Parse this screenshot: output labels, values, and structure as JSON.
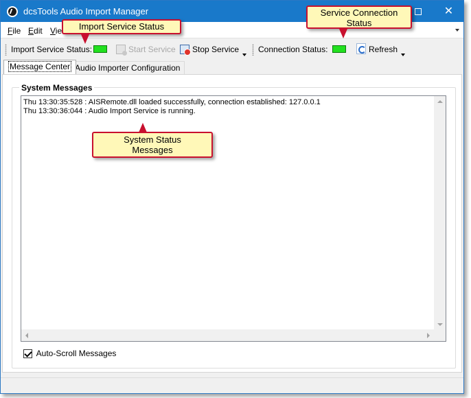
{
  "window": {
    "title": "dcsTools Audio Import Manager"
  },
  "menu": {
    "file": {
      "mnemonic": "F",
      "rest": "ile"
    },
    "edit": {
      "mnemonic": "E",
      "rest": "dit"
    },
    "view": {
      "mnemonic": "V",
      "rest": "ie"
    }
  },
  "toolbar": {
    "import_status_label": "Import Service Status:",
    "start_service_label": "Start Service",
    "stop_service_label": "Stop Service",
    "connection_status_label": "Connection Status:",
    "refresh_label": "Refresh",
    "status_color": "#22e01f"
  },
  "tabs": [
    {
      "label": "Message Center",
      "active": true
    },
    {
      "label": "Audio Importer Configuration",
      "active": false
    }
  ],
  "messages": {
    "group_title": "System Messages",
    "lines": [
      "Thu 13:30:35:528 : AISRemote.dll loaded successfully, connection established: 127.0.0.1",
      "Thu 13:30:36:044 : Audio Import Service is running."
    ]
  },
  "auto_scroll": {
    "label": "Auto-Scroll Messages",
    "checked": true
  },
  "callouts": {
    "import_status": "Import Service Status",
    "connection_status_line1": "Service Connection",
    "connection_status_line2": "Status",
    "system_messages_line1": "System Status",
    "system_messages_line2": "Messages"
  }
}
